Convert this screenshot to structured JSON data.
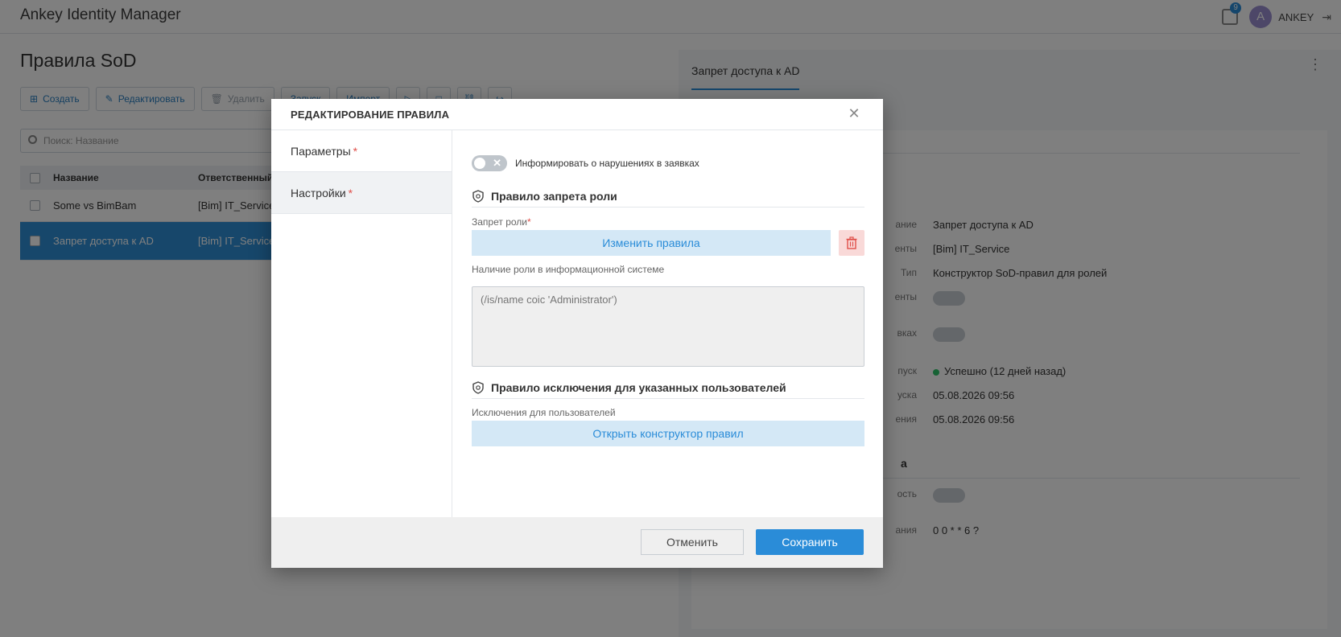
{
  "app": {
    "title": "Ankey Identity Manager",
    "notifications_count": "9",
    "user_initial": "A",
    "user_name": "ANKEY"
  },
  "page": {
    "title": "Правила SoD",
    "toolbar": {
      "create": "Создать",
      "edit": "Редактировать",
      "delete": "Удалить",
      "btn4": "Запуск",
      "btn5": "Импорт"
    },
    "search_placeholder": "Поиск: Название",
    "grid": {
      "columns": [
        "Название",
        "Ответственный"
      ],
      "rows": [
        {
          "name": "Some vs BimBam",
          "responsible": "[Bim] IT_Service"
        },
        {
          "name": "Запрет доступа к AD",
          "responsible": "[Bim] IT_Service"
        }
      ]
    }
  },
  "details": {
    "tab": "Запрет доступа к AD",
    "fields": [
      {
        "key": "ание",
        "value": "Запрет доступа к AD"
      },
      {
        "key": "енты",
        "value": "[Bim] IT_Service"
      },
      {
        "key": "Тип",
        "value": "Конструктор SoD-правил для ролей"
      },
      {
        "key": "енты",
        "value": ""
      },
      {
        "key": "вках",
        "value": ""
      },
      {
        "key": "пуск",
        "value": "Успешно (12 дней назад)"
      },
      {
        "key": "уска",
        "value": "05.08.2026 09:56"
      },
      {
        "key": "ения",
        "value": "05.08.2026 09:56"
      }
    ],
    "section2": "а",
    "fields2": [
      {
        "key": "ость",
        "value": ""
      },
      {
        "key": "ания",
        "value": "0 0 * * 6 ?"
      }
    ]
  },
  "modal": {
    "title": "РЕДАКТИРОВАНИЕ ПРАВИЛА",
    "nav": [
      {
        "label": "Параметры",
        "required": "*"
      },
      {
        "label": "Настройки",
        "required": "*"
      }
    ],
    "notify_toggle_label": "Информировать о нарушениях в заявках",
    "section_role_ban": "Правило запрета роли",
    "role_ban_label": "Запрет роли",
    "role_ban_required": "*",
    "change_rules_button": "Изменить правила",
    "presence_label": "Наличие роли в информационной системе",
    "presence_placeholder": "(/is/name coic 'Administrator')",
    "section_exclusion": "Правило исключения для указанных пользователей",
    "exclusion_label": "Исключения для пользователей",
    "open_builder_button": "Открыть конструктор правил",
    "cancel": "Отменить",
    "save": "Сохранить"
  },
  "colors": {
    "accent": "#2a8cd8",
    "danger_bg": "#f9d9d8",
    "danger_icon": "#e0504a",
    "success": "#2ec46b"
  }
}
